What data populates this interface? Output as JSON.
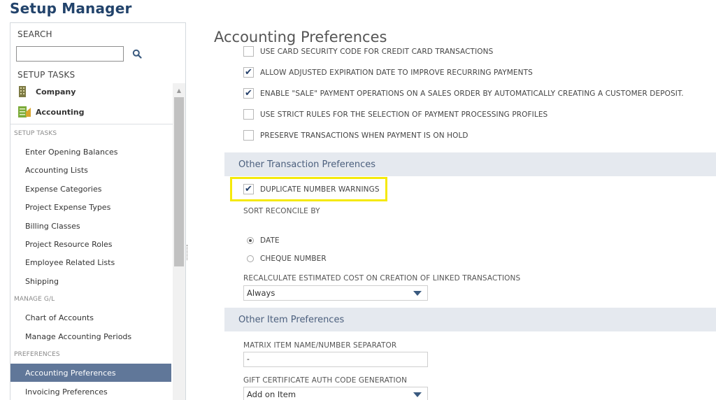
{
  "app_title": "Setup Manager",
  "sidebar": {
    "search_label": "SEARCH",
    "search_value": "",
    "setup_tasks_title": "SETUP TASKS",
    "categories": [
      {
        "label": "Company",
        "icon": "building-icon"
      },
      {
        "label": "Accounting",
        "icon": "ledger-icon"
      }
    ],
    "sections": [
      {
        "label": "SETUP TASKS"
      },
      {
        "label": "MANAGE G/L"
      },
      {
        "label": "PREFERENCES"
      }
    ],
    "items": [
      {
        "label": "Enter Opening Balances"
      },
      {
        "label": "Accounting Lists"
      },
      {
        "label": "Expense Categories"
      },
      {
        "label": "Project Expense Types"
      },
      {
        "label": "Billing Classes"
      },
      {
        "label": "Project Resource Roles"
      },
      {
        "label": "Employee Related Lists"
      },
      {
        "label": "Shipping"
      },
      {
        "label": "Chart of Accounts"
      },
      {
        "label": "Manage Accounting Periods"
      },
      {
        "label": "Accounting Preferences",
        "selected": true
      },
      {
        "label": "Invoicing Preferences"
      }
    ]
  },
  "main": {
    "title": "Accounting Preferences",
    "payment_options": [
      {
        "label": "USE CARD SECURITY CODE FOR CREDIT CARD TRANSACTIONS",
        "checked": false
      },
      {
        "label": "ALLOW ADJUSTED EXPIRATION DATE TO IMPROVE RECURRING PAYMENTS",
        "checked": true
      },
      {
        "label": "ENABLE \"SALE\" PAYMENT OPERATIONS ON A SALES ORDER BY AUTOMATICALLY CREATING A CUSTOMER DEPOSIT.",
        "checked": true
      },
      {
        "label": "USE STRICT RULES FOR THE SELECTION OF PAYMENT PROCESSING PROFILES",
        "checked": false
      },
      {
        "label": "PRESERVE TRANSACTIONS WHEN PAYMENT IS ON HOLD",
        "checked": false
      }
    ],
    "other_transaction": {
      "header": "Other Transaction Preferences",
      "duplicate_warnings_label": "DUPLICATE NUMBER WARNINGS",
      "duplicate_warnings_checked": true,
      "sort_reconcile_label": "SORT RECONCILE BY",
      "radio_options": [
        {
          "label": "DATE",
          "selected": true
        },
        {
          "label": "CHEQUE NUMBER",
          "selected": false
        }
      ],
      "recalc_label": "RECALCULATE ESTIMATED COST ON CREATION OF LINKED TRANSACTIONS",
      "recalc_value": "Always"
    },
    "other_item": {
      "header": "Other Item Preferences",
      "matrix_label": "MATRIX ITEM NAME/NUMBER SEPARATOR",
      "matrix_value": "-",
      "gift_label": "GIFT CERTIFICATE AUTH CODE GENERATION",
      "gift_value": "Add on Item"
    }
  },
  "colors": {
    "brand": "#22436b",
    "selected_item": "#607799",
    "highlight": "#f5e90a",
    "section_bar": "#e5e9ef"
  }
}
